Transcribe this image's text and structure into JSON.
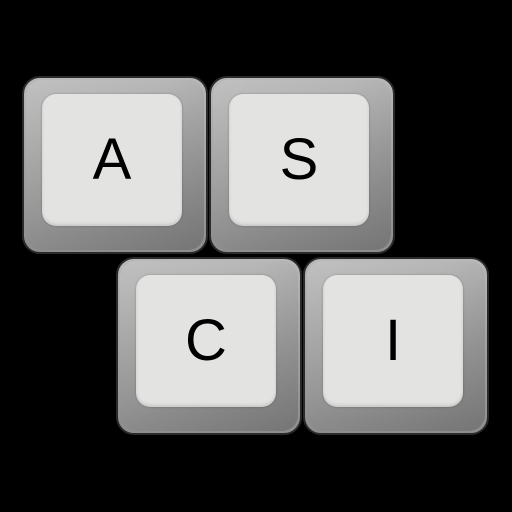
{
  "keys": [
    {
      "label": "A"
    },
    {
      "label": "S"
    },
    {
      "label": "C"
    },
    {
      "label": "I"
    }
  ],
  "colors": {
    "background": "#000000",
    "key_body": "#a4a4a4",
    "key_face": "#e3e4e1",
    "label": "#000000"
  }
}
